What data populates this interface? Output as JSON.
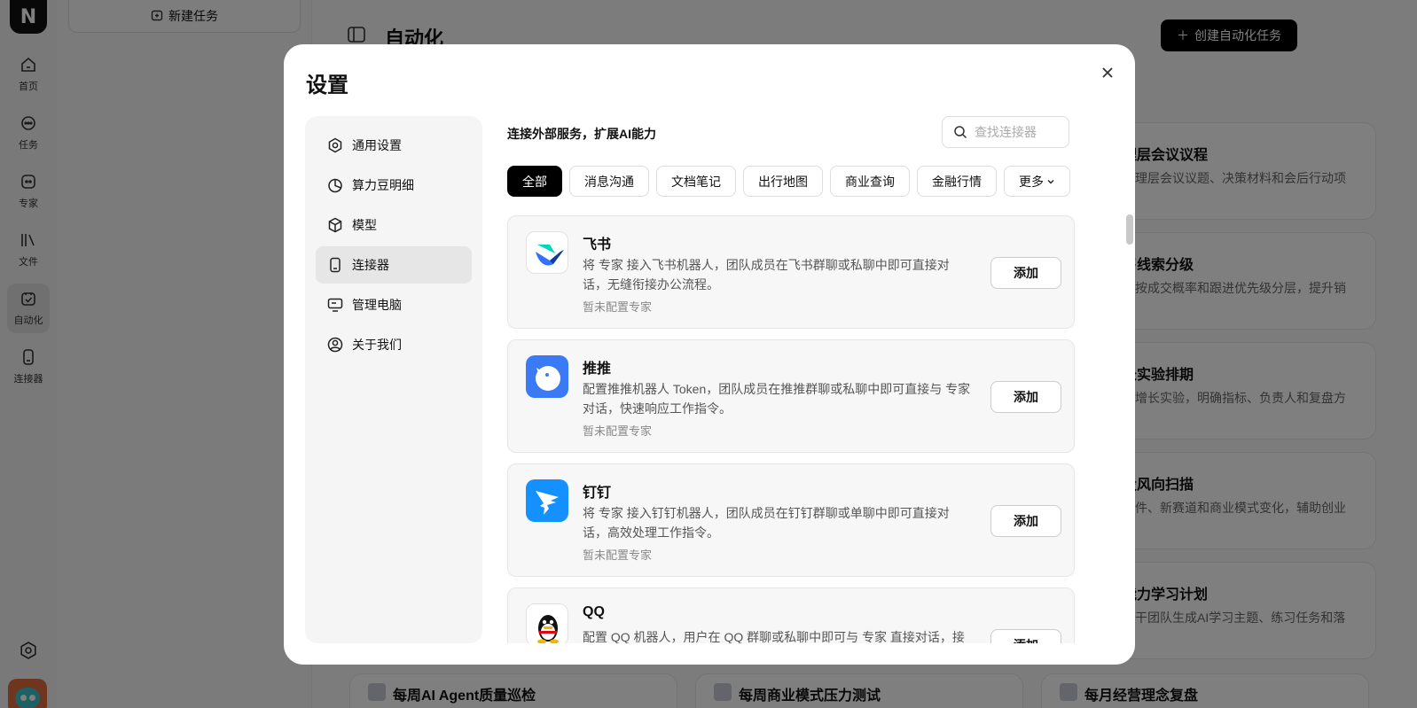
{
  "app": {
    "logo_letter": "N",
    "new_task_label": "新建任务",
    "nav": [
      {
        "label": "首页",
        "icon": "home-icon"
      },
      {
        "label": "任务",
        "icon": "chat-icon"
      },
      {
        "label": "专家",
        "icon": "expert-icon"
      },
      {
        "label": "文件",
        "icon": "files-icon"
      },
      {
        "label": "自动化",
        "icon": "automation-icon"
      },
      {
        "label": "连接器",
        "icon": "connector-icon"
      }
    ]
  },
  "main": {
    "title": "自动化",
    "create_label": "创建自动化任务",
    "cards": [
      {
        "title": "理层会议议程",
        "desc": "管理层会议议题、决策材料和会后行动项"
      },
      {
        "title": "售线索分级",
        "desc": "户按成交概率和跟进优先级分层，提升销"
      },
      {
        "title": "长实验排期",
        "desc": "本增长实验，明确指标、负责人和复盘方"
      },
      {
        "title": "投风向扫描",
        "desc": "事件、新赛道和商业模式变化，辅助创业"
      },
      {
        "title": "能力学习计划",
        "desc": "骨干团队生成AI学习主题、练习任务和落"
      }
    ],
    "bottom_cards": [
      {
        "title": "每周AI Agent质量巡检"
      },
      {
        "title": "每周商业模式压力测试"
      },
      {
        "title": "每月经营理念复盘"
      }
    ]
  },
  "modal": {
    "title": "设置",
    "sidebar": [
      {
        "label": "通用设置",
        "icon": "settings-icon"
      },
      {
        "label": "算力豆明细",
        "icon": "pie-chart-icon"
      },
      {
        "label": "模型",
        "icon": "cube-icon"
      },
      {
        "label": "连接器",
        "icon": "device-icon"
      },
      {
        "label": "管理电脑",
        "icon": "monitor-icon"
      },
      {
        "label": "关于我们",
        "icon": "user-circle-icon"
      }
    ],
    "active_index": 3,
    "subtitle": "连接外部服务，扩展AI能力",
    "search_placeholder": "查找连接器",
    "tabs": [
      "全部",
      "消息沟通",
      "文档笔记",
      "出行地图",
      "商业查询",
      "金融行情",
      "更多"
    ],
    "connectors": [
      {
        "name": "飞书",
        "desc": "将 专家 接入飞书机器人，团队成员在飞书群聊或私聊中即可直接对话，无缝衔接办公流程。",
        "status": "暂未配置专家",
        "button": "添加",
        "logo": "feishu-logo-icon"
      },
      {
        "name": "推推",
        "desc": "配置推推机器人 Token，团队成员在推推群聊或私聊中即可直接与 专家 对话，快速响应工作指令。",
        "status": "暂未配置专家",
        "button": "添加",
        "logo": "tuitui-logo-icon"
      },
      {
        "name": "钉钉",
        "desc": "将 专家 接入钉钉机器人，团队成员在钉钉群聊或单聊中即可直接对话，高效处理工作指令。",
        "status": "暂未配置专家",
        "button": "添加",
        "logo": "dingtalk-logo-icon"
      },
      {
        "name": "QQ",
        "desc": "配置 QQ 机器人，用户在 QQ 群聊或私聊中即可与 专家 直接对话，接入",
        "status": "",
        "button": "添加",
        "logo": "qq-logo-icon"
      }
    ]
  }
}
